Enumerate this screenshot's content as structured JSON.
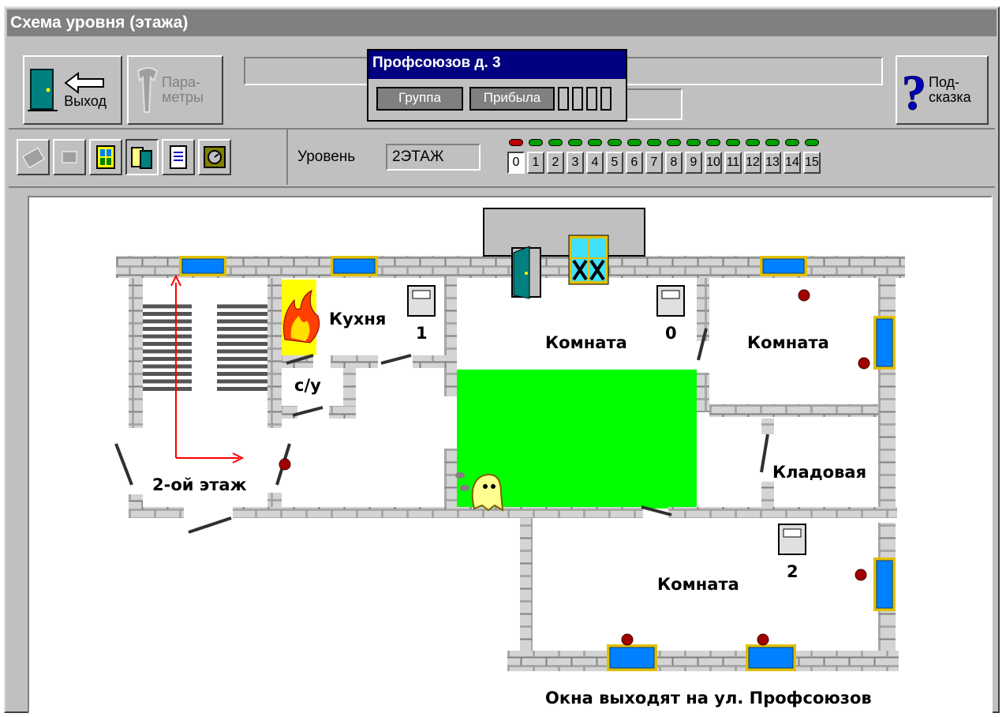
{
  "window": {
    "title": "Схема уровня (этажа)"
  },
  "toolbar": {
    "exit_label": "Выход",
    "params_label_1": "Пара-",
    "params_label_2": "метры",
    "help_label_1": "Под-",
    "help_label_2": "сказка"
  },
  "popup": {
    "title": "Профсоюзов д. 3",
    "group_label": "Группа",
    "arrived_label": "Прибыла"
  },
  "level": {
    "label": "Уровень",
    "value": "2ЭТАЖ",
    "buttons": [
      "0",
      "1",
      "2",
      "3",
      "4",
      "5",
      "6",
      "7",
      "8",
      "9",
      "10",
      "11",
      "12",
      "13",
      "14",
      "15"
    ],
    "active_index": 0
  },
  "colors": {
    "alarm_zone": "#00ff00",
    "led_active": "#c00000",
    "led_ok": "#00a000"
  },
  "plan": {
    "kitchen": "Кухня",
    "bathroom": "с/у",
    "floor": "2-ой этаж",
    "room_a": "Комната",
    "room_b": "Комната",
    "room_c": "Комната",
    "storage": "Кладовая",
    "panel_1": "1",
    "panel_0": "0",
    "panel_2": "2",
    "footer": "Окна выходят на ул. Профсоюзов"
  }
}
